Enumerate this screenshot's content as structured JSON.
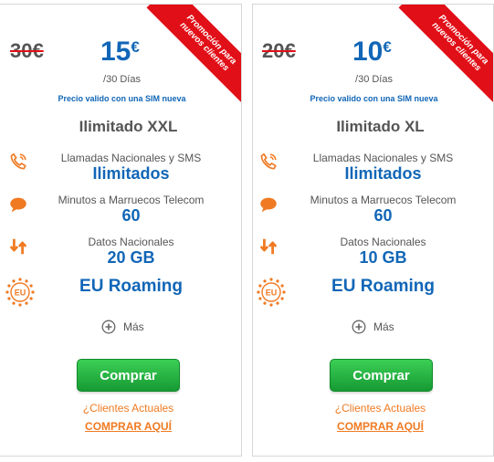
{
  "plans": [
    {
      "ribbon_line1": "Promoción para",
      "ribbon_line2": "nuevos clientes",
      "old_price": "30€",
      "price_number": "15",
      "price_currency": "€",
      "period": "/30 Días",
      "valid_note": "Precio valido con una SIM nueva",
      "plan_name": "Ilimitado XXL",
      "calls_label": "Llamadas Nacionales y SMS",
      "calls_value": "Ilimitados",
      "intl_label": "Minutos a Marruecos Telecom",
      "intl_value": "60",
      "data_label": "Datos Nacionales",
      "data_value": "20 GB",
      "roaming": "EU Roaming",
      "eu_badge": "EU",
      "more_label": "Más",
      "buy_label": "Comprar",
      "clients_label": "¿Clientes Actuales",
      "buy_here_label": "COMPRAR AQUÍ"
    },
    {
      "ribbon_line1": "Promoción para",
      "ribbon_line2": "nuevos clientes",
      "old_price": "20€",
      "price_number": "10",
      "price_currency": "€",
      "period": "/30 Días",
      "valid_note": "Precio valido con una SIM nueva",
      "plan_name": "Ilimitado XL",
      "calls_label": "Llamadas Nacionales y SMS",
      "calls_value": "Ilimitados",
      "intl_label": "Minutos a Marruecos Telecom",
      "intl_value": "60",
      "data_label": "Datos Nacionales",
      "data_value": "10 GB",
      "roaming": "EU Roaming",
      "eu_badge": "EU",
      "more_label": "Más",
      "buy_label": "Comprar",
      "clients_label": "¿Clientes Actuales",
      "buy_here_label": "COMPRAR AQUÍ"
    }
  ],
  "colors": {
    "accent_blue": "#1166b7",
    "promo_red": "#e10f17",
    "icon_orange": "#f07a22",
    "button_green": "#2db84a"
  }
}
